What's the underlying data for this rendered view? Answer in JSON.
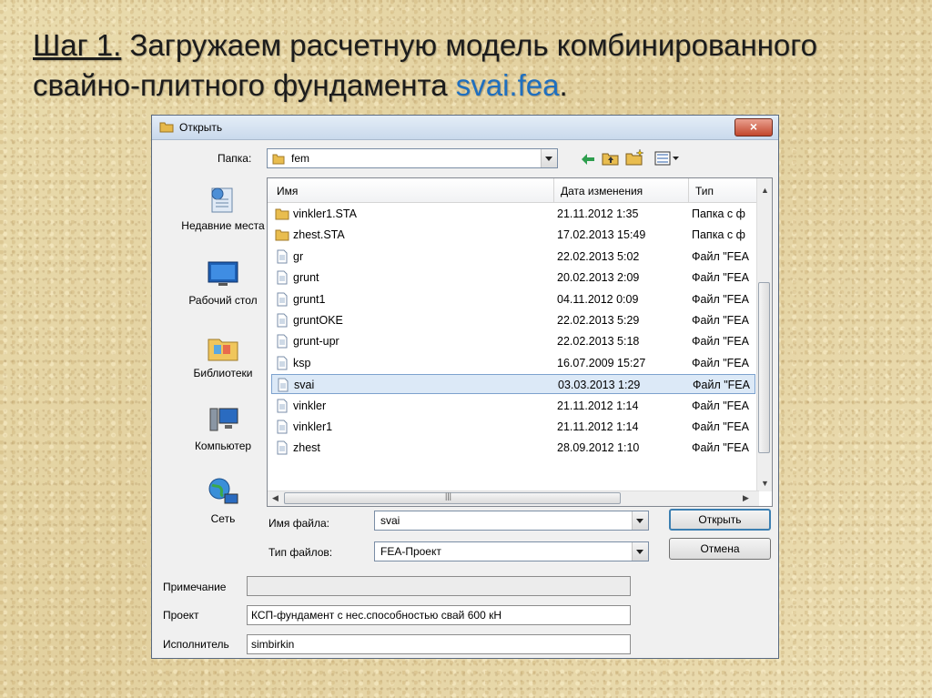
{
  "slide": {
    "title_step": "Шаг 1.",
    "title_text": " Загружаем расчетную модель комбинированного",
    "title_line2": "свайно-плитного фундамента ",
    "title_file": "svai.fea",
    "title_end": "."
  },
  "dialog": {
    "title": "Открыть",
    "close_label": "×",
    "folder_label": "Папка:",
    "folder_value": "fem",
    "places": [
      {
        "label": "Недавние места",
        "icon": "recent-places-icon"
      },
      {
        "label": "Рабочий стол",
        "icon": "desktop-icon"
      },
      {
        "label": "Библиотеки",
        "icon": "libraries-icon"
      },
      {
        "label": "Компьютер",
        "icon": "computer-icon"
      },
      {
        "label": "Сеть",
        "icon": "network-icon"
      }
    ],
    "columns": {
      "name": "Имя",
      "date": "Дата изменения",
      "type": "Тип"
    },
    "files": [
      {
        "name": "vinkler1.STA",
        "date": "21.11.2012 1:35",
        "type": "Папка с ф",
        "kind": "folder"
      },
      {
        "name": "zhest.STA",
        "date": "17.02.2013 15:49",
        "type": "Папка с ф",
        "kind": "folder"
      },
      {
        "name": "gr",
        "date": "22.02.2013 5:02",
        "type": "Файл \"FEA",
        "kind": "file"
      },
      {
        "name": "grunt",
        "date": "20.02.2013 2:09",
        "type": "Файл \"FEA",
        "kind": "file"
      },
      {
        "name": "grunt1",
        "date": "04.11.2012 0:09",
        "type": "Файл \"FEA",
        "kind": "file"
      },
      {
        "name": "gruntOKE",
        "date": "22.02.2013 5:29",
        "type": "Файл \"FEA",
        "kind": "file"
      },
      {
        "name": "grunt-upr",
        "date": "22.02.2013 5:18",
        "type": "Файл \"FEA",
        "kind": "file"
      },
      {
        "name": "ksp",
        "date": "16.07.2009 15:27",
        "type": "Файл \"FEA",
        "kind": "file"
      },
      {
        "name": "svai",
        "date": "03.03.2013 1:29",
        "type": "Файл \"FEA",
        "kind": "file",
        "selected": true
      },
      {
        "name": "vinkler",
        "date": "21.11.2012 1:14",
        "type": "Файл \"FEA",
        "kind": "file"
      },
      {
        "name": "vinkler1",
        "date": "21.11.2012 1:14",
        "type": "Файл \"FEA",
        "kind": "file"
      },
      {
        "name": "zhest",
        "date": "28.09.2012 1:10",
        "type": "Файл \"FEA",
        "kind": "file"
      }
    ],
    "filename_label": "Имя файла:",
    "filename_value": "svai",
    "filetype_label": "Тип файлов:",
    "filetype_value": "FEA-Проект",
    "open_button": "Открыть",
    "cancel_button": "Отмена",
    "note_label": "Примечание",
    "note_value": "",
    "project_label": "Проект",
    "project_value": "КСП-фундамент с нес.способностью свай 600 кН",
    "author_label": "Исполнитель",
    "author_value": "simbirkin",
    "scroll_grip": "|||"
  }
}
